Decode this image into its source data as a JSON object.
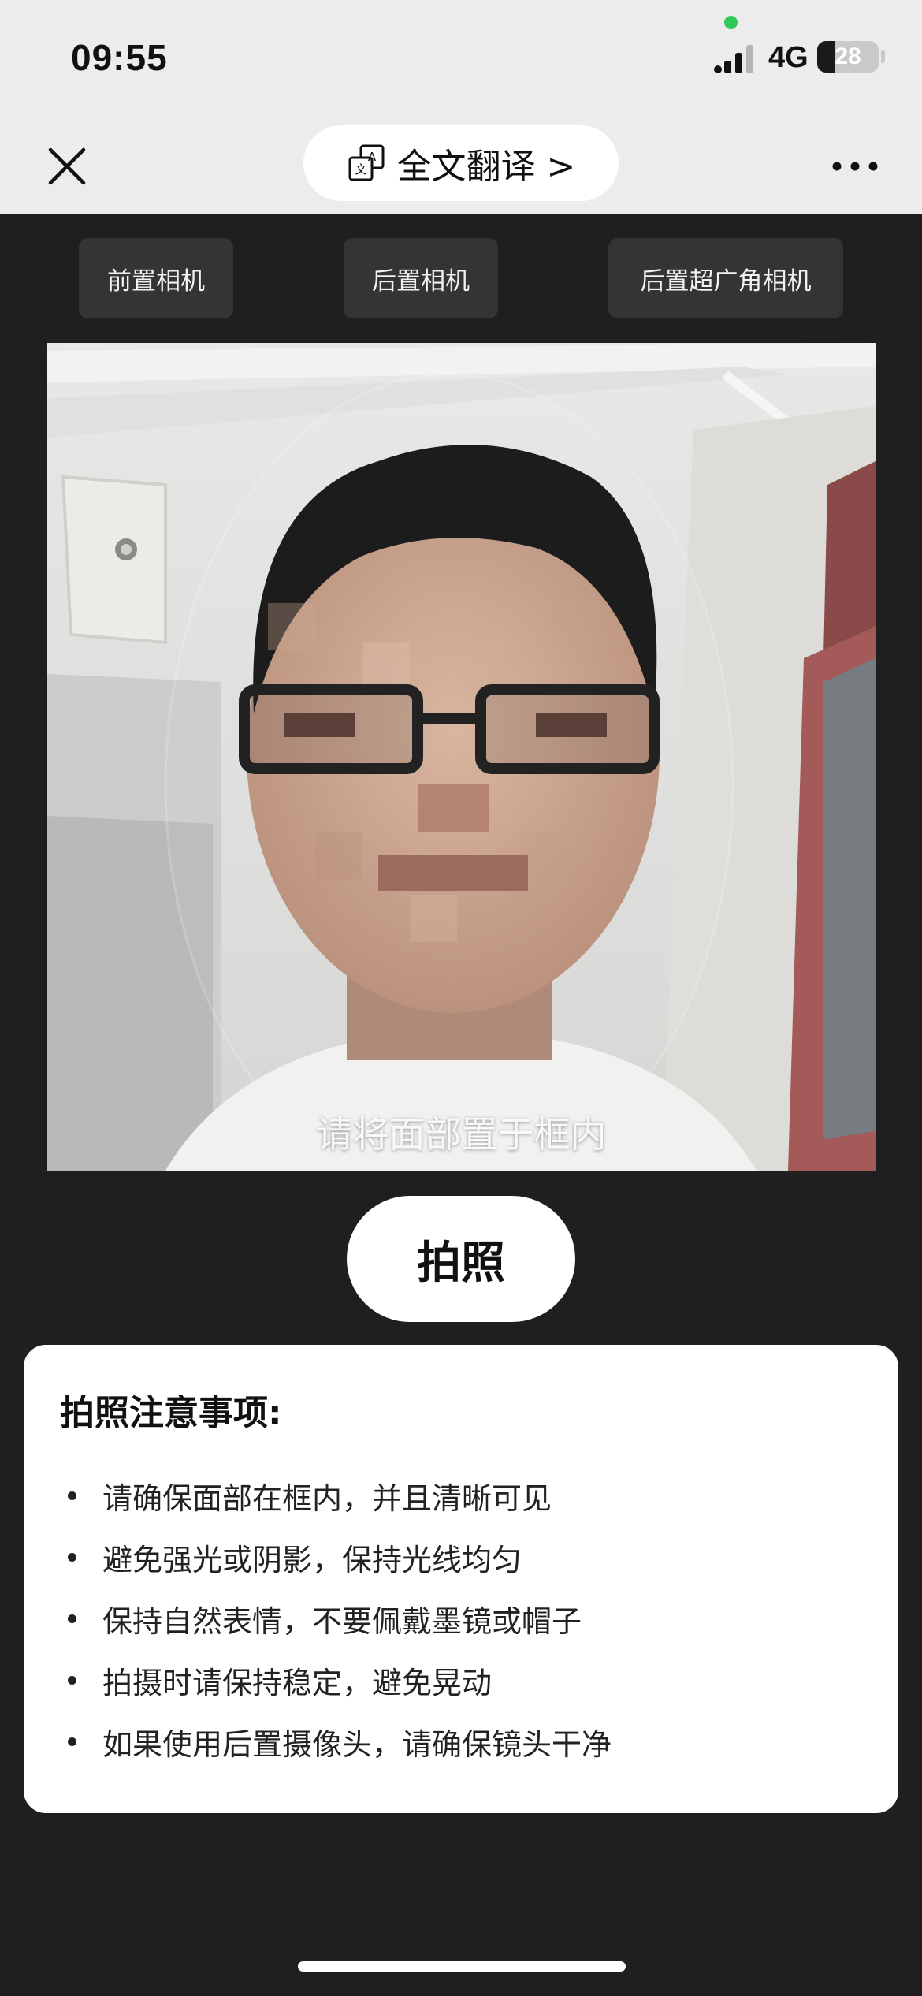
{
  "status_bar": {
    "time": "09:55",
    "network": "4G",
    "battery_level": "28",
    "battery_fraction": 0.28,
    "signal_icon": "cellular-signal-icon",
    "privacy_indicator_color": "#32c759"
  },
  "nav": {
    "close_icon": "close-icon",
    "translate_icon": "translate-icon",
    "translate_label": "全文翻译 >",
    "more_icon": "more-dots-icon"
  },
  "camera_options": [
    {
      "label": "前置相机"
    },
    {
      "label": "后置相机"
    },
    {
      "label": "后置超广角相机"
    }
  ],
  "preview": {
    "hint": "请将面部置于框内"
  },
  "shutter": {
    "label": "拍照"
  },
  "tips": {
    "title": "拍照注意事项:",
    "items": [
      "请确保面部在框内，并且清晰可见",
      "避免强光或阴影，保持光线均匀",
      "保持自然表情，不要佩戴墨镜或帽子",
      "拍摄时请保持稳定，避免晃动",
      "如果使用后置摄像头，请确保镜头干净"
    ]
  },
  "colors": {
    "background": "#1f1f1f",
    "header": "#ececec",
    "camera_button": "#343434",
    "card": "#ffffff"
  }
}
